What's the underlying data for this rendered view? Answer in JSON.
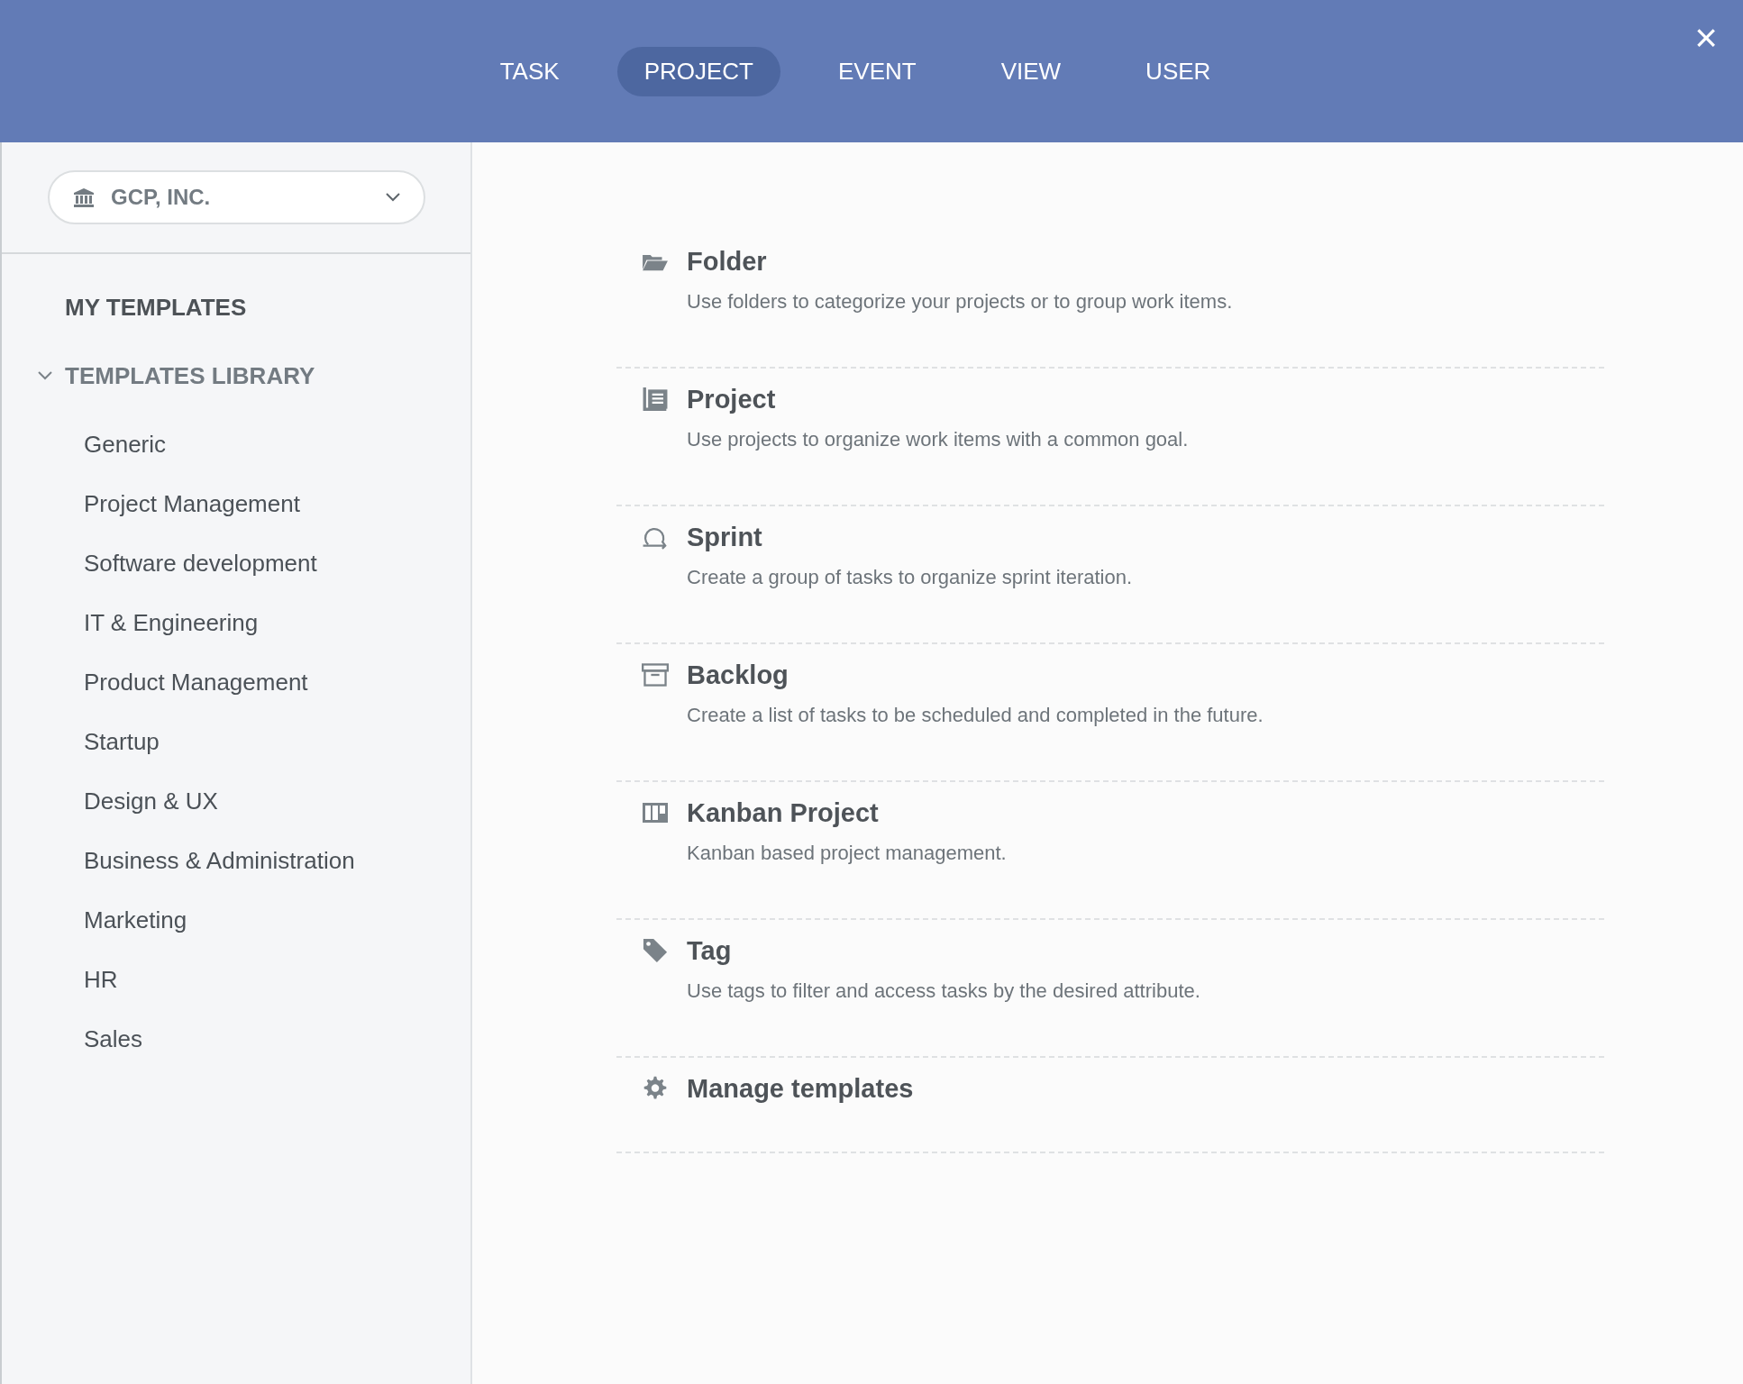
{
  "tabs": [
    {
      "label": "TASK",
      "selected": false
    },
    {
      "label": "PROJECT",
      "selected": true
    },
    {
      "label": "EVENT",
      "selected": false
    },
    {
      "label": "VIEW",
      "selected": false
    },
    {
      "label": "USER",
      "selected": false
    }
  ],
  "close": "×",
  "sidebar": {
    "workspace": "GCP, INC.",
    "my_templates": "MY TEMPLATES",
    "library": {
      "label": "TEMPLATES LIBRARY",
      "expanded": true,
      "items": [
        "Generic",
        "Project Management",
        "Software development",
        "IT & Engineering",
        "Product Management",
        "Startup",
        "Design & UX",
        "Business & Administration",
        "Marketing",
        "HR",
        "Sales"
      ]
    }
  },
  "items": [
    {
      "title": "Folder",
      "description": "Use folders to categorize your projects or to group work items."
    },
    {
      "title": "Project",
      "description": "Use projects to organize work items with a common goal."
    },
    {
      "title": "Sprint",
      "description": "Create a group of tasks to organize sprint iteration."
    },
    {
      "title": "Backlog",
      "description": "Create a list of tasks to be scheduled and completed in the future."
    },
    {
      "title": "Kanban Project",
      "description": "Kanban based project management."
    },
    {
      "title": "Tag",
      "description": "Use tags to filter and access tasks by the desired attribute."
    },
    {
      "title": "Manage templates"
    }
  ]
}
